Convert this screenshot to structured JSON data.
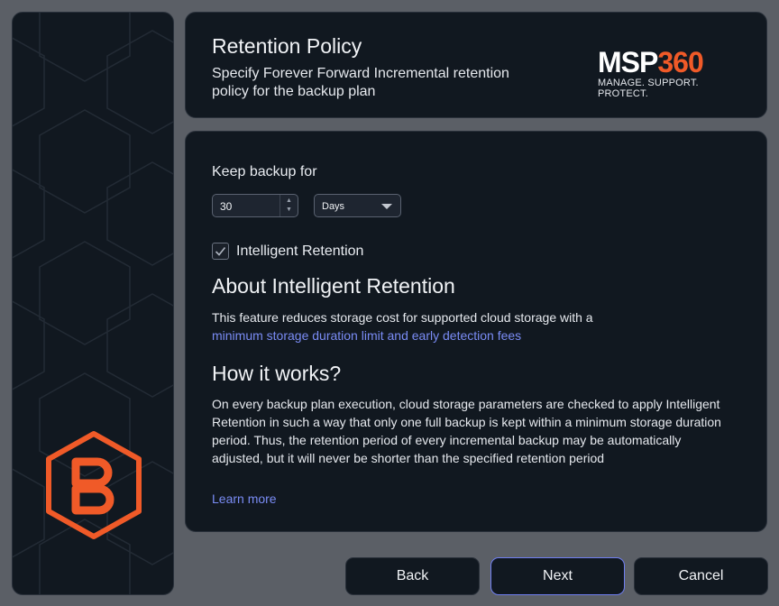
{
  "header": {
    "title": "Retention Policy",
    "subtitle": "Specify Forever Forward Incremental retention policy for the backup plan",
    "brand": {
      "word_white": "MSP",
      "word_orange": "360",
      "tagline": "MANAGE. SUPPORT. PROTECT.",
      "accent": "#f05a28"
    }
  },
  "form": {
    "keep_label": "Keep backup for",
    "keep_value": "30",
    "unit_selected": "Days",
    "intelligent_retention_label": "Intelligent Retention",
    "intelligent_retention_checked": true
  },
  "about": {
    "title": "About Intelligent Retention",
    "text_before_link": "This feature reduces storage cost for supported cloud storage with a ",
    "link_text": "minimum storage duration limit and early detection fees"
  },
  "how": {
    "title": "How it works?",
    "text": "On every backup plan execution, cloud storage parameters are checked to apply Intelligent Retention in such a way that only one full backup is kept within a minimum storage duration period. Thus, the retention period of every incremental backup may be automatically adjusted, but it will never be shorter than the specified retention period",
    "learn_more": "Learn more"
  },
  "buttons": {
    "back": "Back",
    "next": "Next",
    "cancel": "Cancel"
  },
  "colors": {
    "panel": "#111820",
    "link": "#7a8cf5",
    "logo_orange": "#f05a28",
    "focus": "#6f7ef0"
  }
}
